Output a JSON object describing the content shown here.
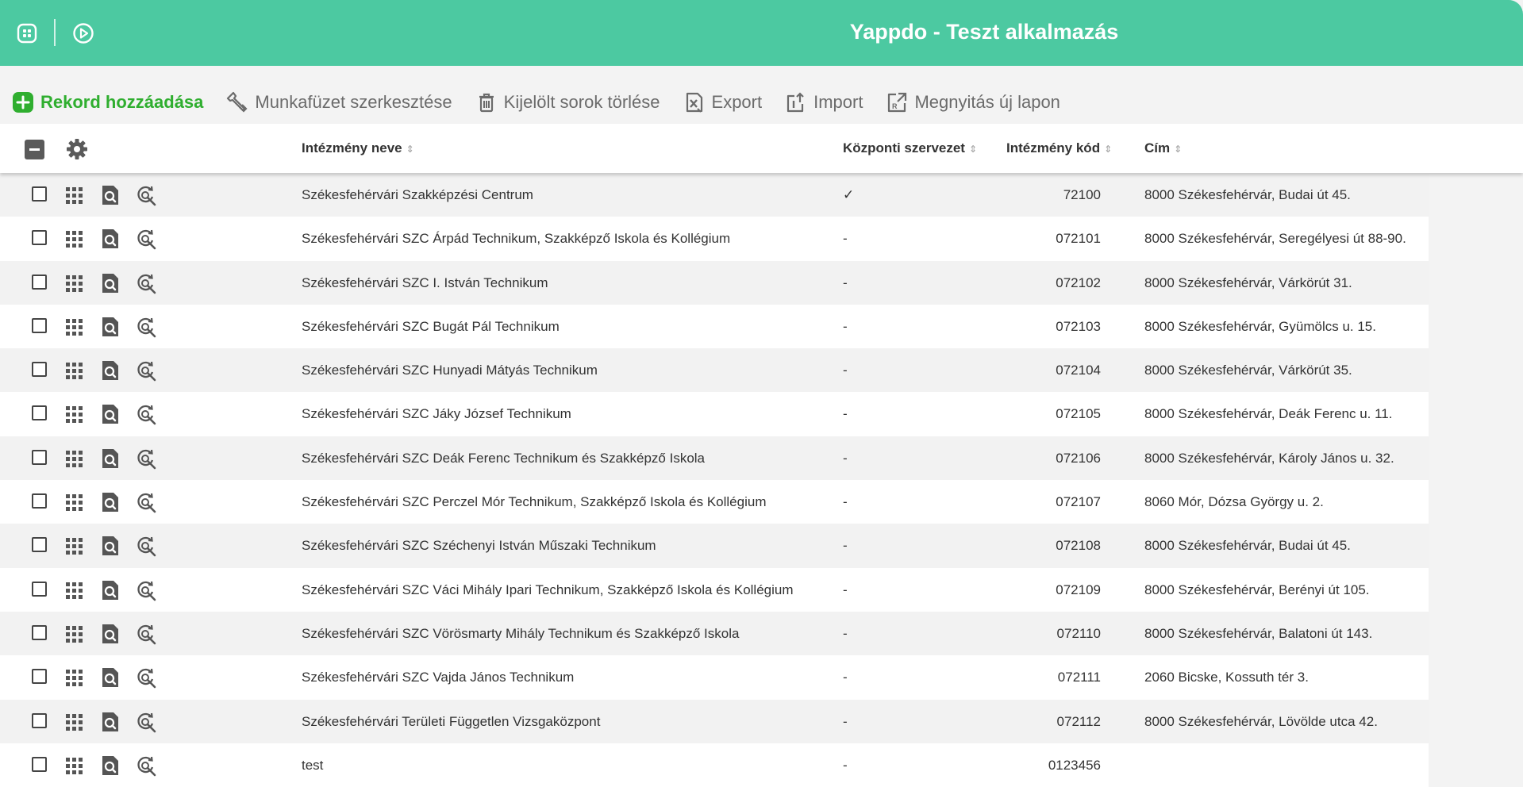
{
  "app": {
    "title": "Yappdo - Teszt alkalmazás"
  },
  "toolbar": {
    "add_label": "Rekord hozzáadása",
    "edit_workbook_label": "Munkafüzet szerkesztése",
    "delete_label": "Kijelölt sorok törlése",
    "export_label": "Export",
    "import_label": "Import",
    "open_new_tab_label": "Megnyitás új lapon"
  },
  "colors": {
    "header_bg": "#4cc9a1",
    "add_green": "#2fae2f"
  },
  "table": {
    "columns": {
      "name": "Intézmény neve",
      "central": "Központi szervezet",
      "code": "Intézmény kód",
      "address": "Cím"
    },
    "rows": [
      {
        "name": "Székesfehérvári Szakképzési Centrum",
        "central": "✓",
        "code": "72100",
        "address": "8000 Székesfehérvár, Budai út 45."
      },
      {
        "name": "Székesfehérvári SZC Árpád Technikum, Szakképző Iskola és Kollégium",
        "central": "-",
        "code": "072101",
        "address": "8000 Székesfehérvár, Seregélyesi út 88-90."
      },
      {
        "name": "Székesfehérvári SZC I. István Technikum",
        "central": "-",
        "code": "072102",
        "address": "8000 Székesfehérvár, Várkörút 31."
      },
      {
        "name": "Székesfehérvári SZC Bugát Pál Technikum",
        "central": "-",
        "code": "072103",
        "address": "8000 Székesfehérvár, Gyümölcs u. 15."
      },
      {
        "name": "Székesfehérvári SZC Hunyadi Mátyás Technikum",
        "central": "-",
        "code": "072104",
        "address": "8000 Székesfehérvár, Várkörút 35."
      },
      {
        "name": "Székesfehérvári SZC Jáky József Technikum",
        "central": "-",
        "code": "072105",
        "address": "8000 Székesfehérvár, Deák Ferenc u. 11."
      },
      {
        "name": "Székesfehérvári SZC Deák Ferenc Technikum és Szakképző Iskola",
        "central": "-",
        "code": "072106",
        "address": "8000 Székesfehérvár, Károly János u. 32."
      },
      {
        "name": "Székesfehérvári SZC Perczel Mór Technikum, Szakképző Iskola és Kollégium",
        "central": "-",
        "code": "072107",
        "address": "8060 Mór, Dózsa György u. 2."
      },
      {
        "name": "Székesfehérvári SZC Széchenyi István Műszaki Technikum",
        "central": "-",
        "code": "072108",
        "address": "8000 Székesfehérvár, Budai út 45."
      },
      {
        "name": "Székesfehérvári SZC Váci Mihály Ipari Technikum, Szakképző Iskola és Kollégium",
        "central": "-",
        "code": "072109",
        "address": "8000 Székesfehérvár, Berényi út 105."
      },
      {
        "name": "Székesfehérvári SZC Vörösmarty Mihály Technikum és Szakképző Iskola",
        "central": "-",
        "code": "072110",
        "address": "8000 Székesfehérvár, Balatoni út 143."
      },
      {
        "name": "Székesfehérvári SZC Vajda János Technikum",
        "central": "-",
        "code": "072111",
        "address": "2060 Bicske, Kossuth tér 3."
      },
      {
        "name": "Székesfehérvári Területi Független Vizsgaközpont",
        "central": "-",
        "code": "072112",
        "address": "8000 Székesfehérvár, Lövölde utca 42."
      },
      {
        "name": "test",
        "central": "-",
        "code": "0123456",
        "address": ""
      }
    ]
  }
}
